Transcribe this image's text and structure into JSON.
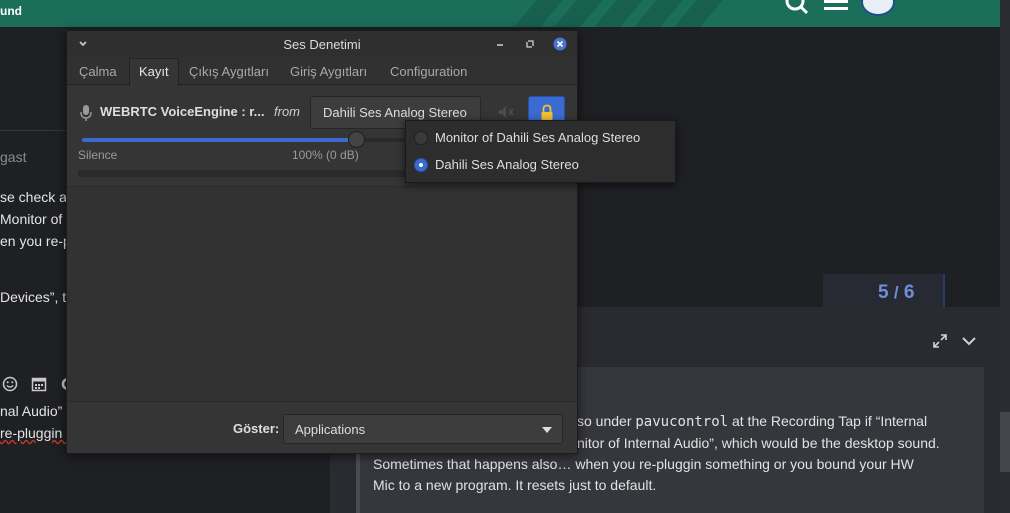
{
  "background": {
    "header_title": "und",
    "left_text": {
      "author": "gast",
      "line1": "se check a",
      "line2": "Monitor of",
      "line3": "en you re-p",
      "line4": "Devices”, th",
      "editor_line1": "nal Audio”",
      "editor_line2": "re-pluggin s"
    },
    "topic_progress": {
      "current": "5",
      "separator": "/",
      "total": "6"
    },
    "quote": {
      "line1_a": "so under ",
      "line1_code": "pavucontrol",
      "line1_b": " at the Recording Tap if “Internal",
      "line2": "nitor of Internal Audio”, which would be the desktop sound.",
      "line3": "Sometimes that happens also… when you re-pluggin something or you bound your HW",
      "line4": "Mic to a new program. It resets just to default."
    }
  },
  "window": {
    "title": "Ses Denetimi",
    "tabs": [
      {
        "label": "Çalma"
      },
      {
        "label": "Kayıt"
      },
      {
        "label": "Çıkış Aygıtları"
      },
      {
        "label": "Giriş Aygıtları"
      },
      {
        "label": "Configuration"
      }
    ],
    "active_tab": "Kayıt",
    "stream": {
      "name": "WEBRTC VoiceEngine : r...",
      "from_label": "from",
      "device": "Dahili Ses Analog Stereo",
      "scale_min_label": "Silence",
      "scale_mid_label": "100% (0 dB)",
      "volume_percent": 100
    },
    "footer": {
      "show_label": "Göster:",
      "show_value": "Applications"
    }
  },
  "device_popup": {
    "options": [
      {
        "label": "Monitor of Dahili Ses Analog Stereo",
        "selected": false
      },
      {
        "label": "Dahili Ses Analog Stereo",
        "selected": true
      }
    ]
  },
  "colors": {
    "accent": "#3b6bd1",
    "header_green": "#1b6e5a",
    "window_bg": "#353535"
  }
}
